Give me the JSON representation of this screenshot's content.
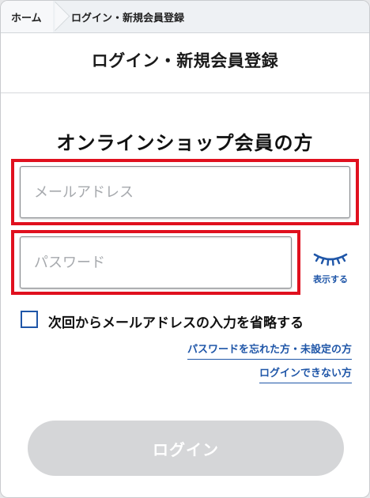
{
  "breadcrumb": {
    "home_label": "ホーム",
    "current_label": "ログイン・新規会員登録"
  },
  "header": {
    "title": "ログイン・新規会員登録"
  },
  "main": {
    "section_title": "オンラインショップ会員の方",
    "email": {
      "placeholder": "メールアドレス",
      "value": ""
    },
    "password": {
      "placeholder": "パスワード",
      "value": ""
    },
    "show_password": {
      "label": "表示する",
      "icon": "eye-closed-icon"
    },
    "remember": {
      "label": "次回からメールアドレスの入力を省略する",
      "checked": false
    },
    "links": {
      "forgot_password": "パスワードを忘れた方・未設定の方",
      "cannot_login": "ログインできない方"
    },
    "login_button": {
      "label": "ログイン"
    }
  },
  "colors": {
    "highlight": "#e0101e",
    "accent": "#1f56a8",
    "button_disabled": "#d5d6d8"
  }
}
